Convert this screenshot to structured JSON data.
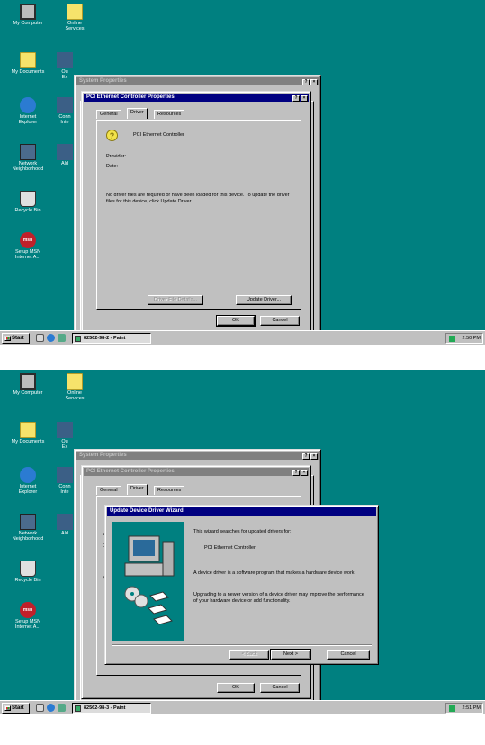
{
  "desktop_icons": {
    "my_computer": "My Computer",
    "online_services_1": "Online",
    "online_services_2": "Services",
    "my_documents": "My Documents",
    "internet_explorer_1": "Internet",
    "internet_explorer_2": "Explorer",
    "network_1": "Network",
    "network_2": "Neighborhood",
    "recycle_bin": "Recycle Bin",
    "msn_icon_text": "msn",
    "setup_msn_1": "Setup MSN",
    "setup_msn_2": "Internet A...",
    "partial_1": "Ou",
    "partial_2": "Ex",
    "partial_3": "Conn",
    "partial_4": "Inte",
    "partial_5": "Ald"
  },
  "screen1": {
    "system_properties_title": "System Properties",
    "behind_tab_fragment": "Gr",
    "pci_dialog_title": "PCI Ethernet Controller Properties",
    "tabs": [
      "General",
      "Driver",
      "Resources"
    ],
    "device_name": "PCI Ethernet Controller",
    "provider_label": "Provider:",
    "date_label": "Date:",
    "driver_message": "No driver files are required or have been loaded for this device.  To update the driver files for this device, click Update Driver.",
    "driver_file_details": "Driver File Details...",
    "update_driver": "Update Driver...",
    "ok": "OK",
    "cancel": "Cancel",
    "start": "Start",
    "taskbar_item": "82562-98-2 - Paint",
    "clock": "2:50 PM"
  },
  "screen2": {
    "system_properties_title": "System Properties",
    "behind_tab_fragment": "Gr",
    "pci_dialog_title": "PCI Ethernet Controller Properties",
    "tabs": [
      "General",
      "Driver",
      "Resources"
    ],
    "behind_frag_p": "P",
    "behind_frag_d": "D",
    "behind_frag_n": "N",
    "behind_frag_u": "u",
    "wizard_title": "Update Device Driver Wizard",
    "wizard_intro": "This wizard searches for updated drivers for:",
    "wizard_device": "PCI Ethernet Controller",
    "wizard_para1": "A device driver is a software program that makes a hardware device work.",
    "wizard_para2": "Upgrading to a newer version of a device driver may improve the performance of your hardware device or add functionality.",
    "back": "< Back",
    "next": "Next >",
    "cancel": "Cancel",
    "ok": "OK",
    "cancel_props": "Cancel",
    "start": "Start",
    "taskbar_item": "82562-98-3 - Paint",
    "clock": "2:51 PM"
  },
  "colors": {
    "desktop": "#008080",
    "title_active": "#000080",
    "title_inactive": "#808080",
    "face": "#c0c0c0"
  }
}
